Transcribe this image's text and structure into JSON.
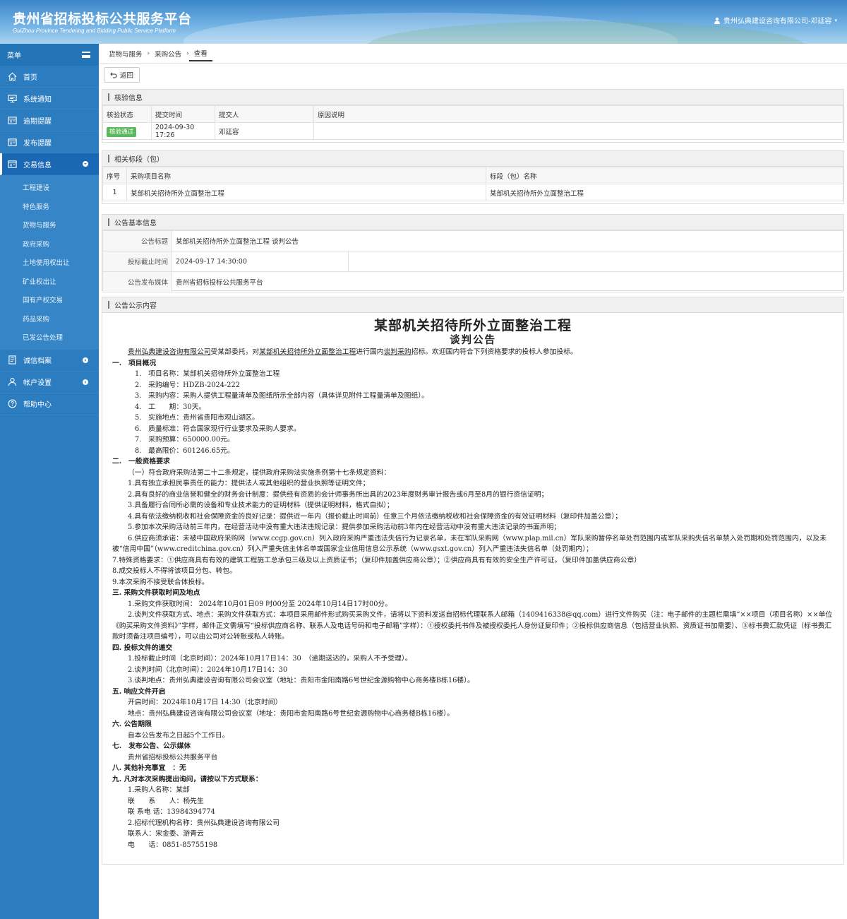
{
  "header": {
    "title": "贵州省招标投标公共服务平台",
    "subtitle": "GuiZhou Province Tendering and Bidding Public Service Platform",
    "user": "贵州弘典建设咨询有限公司-邓廷容"
  },
  "sidebar": {
    "menu_label": "菜单",
    "items": [
      {
        "label": "首页",
        "icon": "home-icon"
      },
      {
        "label": "系统通知",
        "icon": "monitor-icon"
      },
      {
        "label": "逾期提醒",
        "icon": "list-icon"
      },
      {
        "label": "发布提醒",
        "icon": "list-icon"
      },
      {
        "label": "交易信息",
        "icon": "list-icon"
      },
      {
        "label": "诚信档案",
        "icon": "document-icon"
      },
      {
        "label": "帐户设置",
        "icon": "user-icon"
      },
      {
        "label": "帮助中心",
        "icon": "help-icon"
      }
    ],
    "sub_items": [
      "工程建设",
      "特色服务",
      "货物与服务",
      "政府采购",
      "土地使用权出让",
      "矿业权出让",
      "国有产权交易",
      "药品采购",
      "已发公告处理"
    ]
  },
  "breadcrumb": [
    "货物与服务",
    "采购公告",
    "查看"
  ],
  "toolbar": {
    "back_label": "返回"
  },
  "verify": {
    "title": "核验信息",
    "headers": [
      "核验状态",
      "提交时间",
      "提交人",
      "原因说明"
    ],
    "row": {
      "status": "核验通过",
      "time": "2024-09-30 17:26",
      "submitter": "邓廷容",
      "reason": ""
    }
  },
  "sections_panel": {
    "title": "相关标段（包）",
    "headers": [
      "序号",
      "采购项目名称",
      "标段（包）名称"
    ],
    "row": {
      "no": "1",
      "project": "某部机关招待所外立面整治工程",
      "section": "某部机关招待所外立面整治工程"
    }
  },
  "basic": {
    "title": "公告基本信息",
    "rows": [
      {
        "k": "公告标题",
        "v": "某部机关招待所外立面整治工程 谈判公告"
      },
      {
        "k": "投标截止时间",
        "v": "2024-09-17 14:30:00"
      },
      {
        "k": "公告发布媒体",
        "v": "贵州省招标投标公共服务平台"
      }
    ]
  },
  "content": {
    "title": "公告公示内容",
    "doc_title": "某部机关招待所外立面整治工程",
    "doc_subtitle": "谈判公告",
    "intro": {
      "agent": "贵州弘典建设咨询有限公司",
      "t1": "受某部委托，对",
      "project": "某部机关招待所外立面整治工程",
      "t2": "进行国内",
      "method": "谈判采购",
      "t3": "招标。欢迎国内符合下列资格要求的投标人参加投标。"
    },
    "s1": "一.　项目概况",
    "s1_items": [
      "1.　项目名称：某部机关招待所外立面整治工程",
      "2.　采购编号：HDZB-2024-222",
      "3.　采购内容：采购人提供工程量清单及图纸所示全部内容（具体详见附件工程量清单及图纸）。",
      "4.　工　　期：30天。",
      "5.　实施地点：贵州省贵阳市观山湖区。",
      "6.　质量标准：符合国家现行行业要求及采购人要求。",
      "7.　采购预算：650000.00元。",
      "8.　最高限价：601246.65元。"
    ],
    "s2": "二.　一般资格要求",
    "s2_lead": "（一）符合政府采购法第二十二条规定，提供政府采购法实施条例第十七条规定资料：",
    "s2_items": [
      "1.具有独立承担民事责任的能力：提供法人或其他组织的营业执照等证明文件；",
      "2.具有良好的商业信誉和健全的财务会计制度：提供经有资质的会计师事务所出具的2023年度财务审计报告或6月至8月的银行资信证明；",
      "3.具备履行合同所必需的设备和专业技术能力的证明材料（提供证明材料，格式自拟）；",
      "4.具有依法缴纳税收和社会保障资金的良好记录：提供近一年内（报价截止时间前）任意三个月依法缴纳税收和社会保障资金的有效证明材料（复印件加盖公章）；",
      "5.参加本次采购活动前三年内，在经营活动中没有重大违法违规记录：提供参加采购活动前3年内在经营活动中没有重大违法记录的书面声明；",
      "6.供应商须承诺：未被中国政府采购网（www.ccgp.gov.cn）列入政府采购严重违法失信行为记录名单，未在军队采购网（www.plap.mil.cn）军队采购暂停名单处罚范围内或军队采购失信名单禁入处罚期和处罚范围内，以及未被“信用中国”（www.creditchina.gov.cn）列入严重失信主体名单或国家企业信用信息公示系统（www.gsxt.gov.cn）列入严重违法失信名单（处罚期内）；"
    ],
    "s2_extra": [
      "7.特殊资格要求：①供应商具有有效的建筑工程施工总承包三级及以上资质证书；（复印件加盖供应商公章）；②供应商具有有效的安全生产许可证。（复印件加盖供应商公章）",
      "8.成交投标人不得将该项目分包、转包。",
      "9.本次采购不接受联合体投标。"
    ],
    "s3": "三. 采购文件获取时间及地点",
    "s3_items": [
      "1.采购文件获取时间： 2024年10月01日09 时00分至 2024年10月14日17时00分。",
      "2.谈判文件获取方式、地点：采购文件获取方式：本项目采用邮件形式购买采购文件，请将以下资料发送自招标代理联系人邮箱（1409416338@qq.com）进行文件购买（注：电子邮件的主题栏需填“××项目（项目名称）××单位《购买采购文件资料》”字样，邮件正文需填写“投标供应商名称、联系人及电话号码和电子邮箱”字样）：①授权委托书件及被授权委托人身份证复印件；②投标供应商信息（包括营业执照、资质证书加需要）、③标书费汇款凭证（标书费汇款时须备注项目编号），可以由公司对公转账或私人转账。"
    ],
    "s4": "四. 投标文件的递交",
    "s4_items": [
      "1.投标截止时间（北京时间）：2024年10月17日14：30　（逾期送达的，采购人不予受理）。",
      "2.谈判时间（北京时间）：2024年10月17日14：30",
      "3.谈判地点：贵州弘典建设咨询有限公司会议室（地址：贵阳市金阳南路6号世纪金源购物中心商务楼B栋16楼）。"
    ],
    "s5": "五. 响应文件开启",
    "s5_items": [
      "开启时间：2024年10月17日 14:30（北京时间）",
      "地点：贵州弘典建设咨询有限公司会议室（地址：贵阳市金阳南路6号世纪金源购物中心商务楼B栋16楼）。"
    ],
    "s6": "六. 公告期限",
    "s6_items": [
      "自本公告发布之日起5个工作日。"
    ],
    "s7": "七.　发布公告、公示媒体",
    "s7_items": [
      "贵州省招标投标公共服务平台"
    ],
    "s8": "八. 其他补充事宜　：无",
    "s9": "九. 凡对本次采购提出询问，请按以下方式联系：",
    "s9_items": [
      "1.采购人名称：某部",
      "联　　系　　人：杨先生",
      "联 系电 话：13984394774",
      "2.招标代理机构名称：贵州弘典建设咨询有限公司",
      "联系人：宋金委、游青云",
      "电　　话：0851-85755198"
    ]
  }
}
